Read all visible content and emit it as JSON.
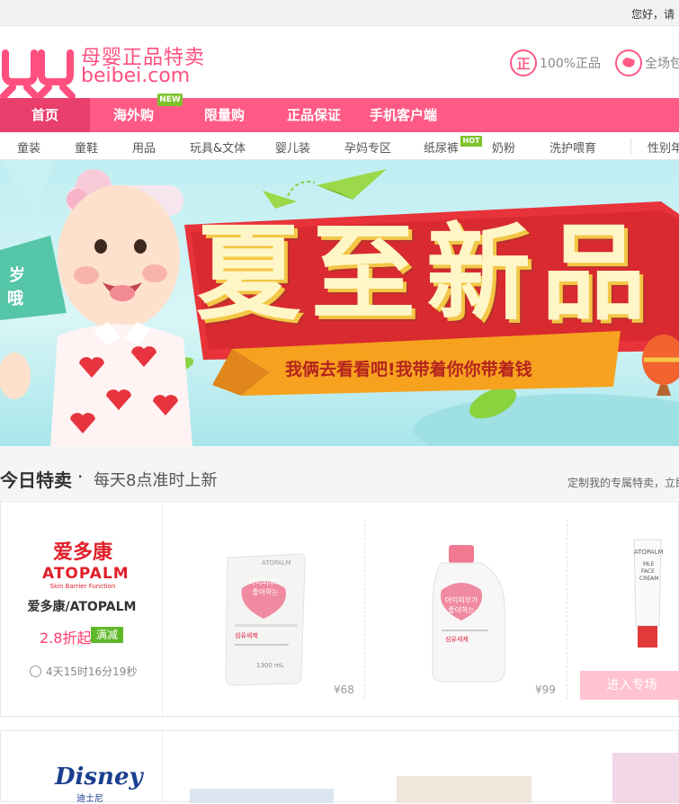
{
  "topbar": {
    "greeting": "您好，",
    "greeting_cut": "请"
  },
  "header": {
    "logo_cn": "母婴正品特卖",
    "logo_en": "beibei.com",
    "badges": [
      {
        "icon": "zheng-icon",
        "icon_char": "正",
        "label": "100%正品"
      },
      {
        "icon": "china-map-icon",
        "label": "全场包"
      }
    ]
  },
  "nav": {
    "items": [
      "首页",
      "海外购",
      "限量购",
      "正品保证",
      "手机客户端"
    ],
    "new_tag": "NEW"
  },
  "categories": {
    "items": [
      "童装",
      "童鞋",
      "用品",
      "玩具&文体",
      "婴儿装",
      "孕妈专区",
      "纸尿裤",
      "奶粉",
      "洗护喂育",
      "性别年"
    ],
    "hot_tag": "HOT"
  },
  "banner": {
    "side_text_1": "岁",
    "side_text_2": "哦",
    "headline": "夏至新品",
    "ribbon": "我俩去看看吧!我带着你你带着钱"
  },
  "today": {
    "title": "今日特卖",
    "dot": "·",
    "subtitle": "每天8点准时上新",
    "link": "定制我的专属特卖，立即"
  },
  "deal1": {
    "brand_logo_cn": "爱多康",
    "brand_logo_en": "ATOPALM",
    "brand_logo_tag": "Skin Barrier Function",
    "brand_name": "爱多康/ATOPALM",
    "discount": "2.8折起",
    "tag": "满减",
    "timer": "4天15时16分19秒",
    "products": [
      {
        "name": "refill-pouch",
        "price": "¥68",
        "label_kr": "아이피부가 좋아하는",
        "label_kr2": "섬유세제",
        "vol": "1300 mL",
        "brand": "ATOPALM"
      },
      {
        "name": "detergent-bottle",
        "price": "¥99",
        "label_kr": "아이피부가 좋아하는",
        "label_kr2": "섬유세제"
      },
      {
        "name": "cream-tube",
        "brand": "ATOPALM",
        "line1": "MLE",
        "line2": "FACE",
        "line3": "CREAM"
      }
    ],
    "enter_button": "进入专场"
  },
  "deal2": {
    "brand_logo": "Disney",
    "brand_sub": "迪士尼"
  },
  "colors": {
    "brand": "#ff5a86",
    "nav_active": "#e83f6d",
    "green": "#5fb82a",
    "price_red": "#ff3c6e"
  }
}
